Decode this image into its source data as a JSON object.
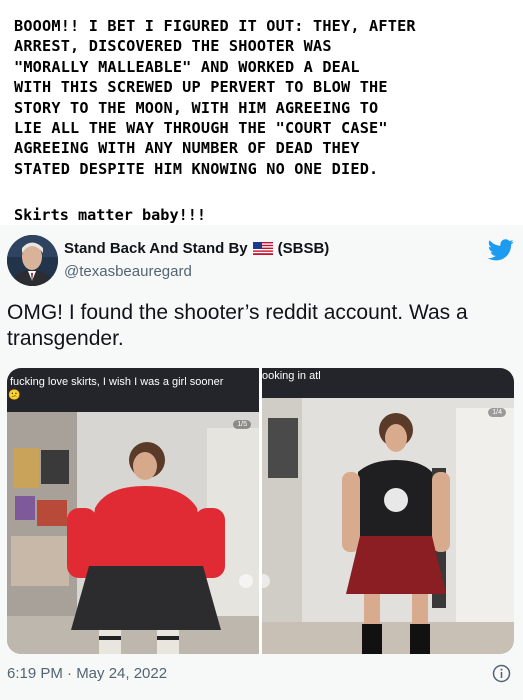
{
  "caption": {
    "lines": [
      "BOOOM!! I BET I FIGURED IT OUT:  THEY, AFTER",
      "ARREST, DISCOVERED THE SHOOTER WAS",
      "\"MORALLY MALLEABLE\" AND WORKED A DEAL",
      "WITH THIS SCREWED UP PERVERT TO BLOW THE",
      "STORY TO THE MOON, WITH HIM AGREEING TO",
      "LIE ALL THE WAY THROUGH THE \"COURT CASE\"",
      "AGREEING WITH ANY NUMBER OF DEAD THEY",
      "STATED DESPITE HIM KNOWING NO ONE DIED."
    ],
    "tagline": "Skirts matter baby!!!"
  },
  "tweet": {
    "display_name": "Stand Back And Stand By",
    "name_suffix": "(SBSB)",
    "handle": "@texasbeauregard",
    "text": "OMG! I found the shooter’s reddit account. Was a transgender.",
    "timestamp": "6:19 PM · May 24, 2022",
    "icons": {
      "flag": "us-flag-icon",
      "brand": "twitter-bird-icon",
      "info": "info-icon"
    },
    "colors": {
      "brand": "#1d9bf0",
      "secondary_text": "#536471"
    }
  },
  "media": {
    "left": {
      "overlay_text": "fucking love skirts, I wish I was a girl sooner",
      "emoji": "😕",
      "counter": "1/5"
    },
    "right": {
      "overlay_text": "ooking in atl",
      "counter": "1/4"
    }
  }
}
